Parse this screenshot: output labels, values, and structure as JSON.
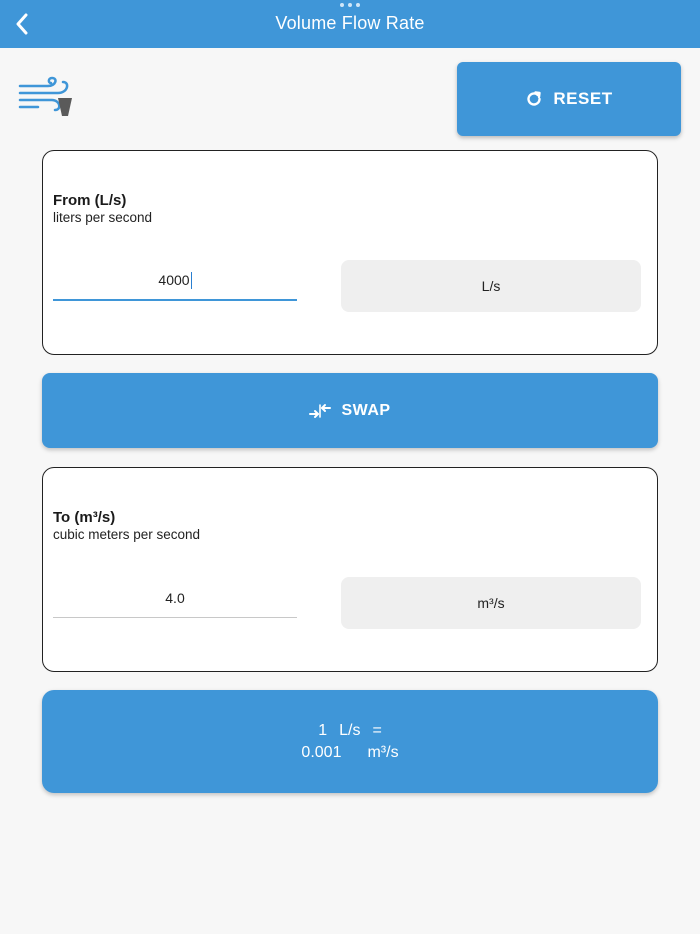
{
  "header": {
    "title": "Volume Flow Rate",
    "back_icon": "chevron-left-icon",
    "background": "#3f96d8"
  },
  "logo_icon": "wind-flow-icon",
  "reset": {
    "label": "RESET",
    "icon": "refresh-icon"
  },
  "from": {
    "title": "From (L/s)",
    "subtitle": "liters per second",
    "value": "4000",
    "unit": "L/s"
  },
  "swap": {
    "label": "SWAP",
    "icon": "swap-arrows-icon"
  },
  "to": {
    "title": "To (m³/s)",
    "subtitle": "cubic meters per second",
    "value": "4.0",
    "unit": "m³/s"
  },
  "result": {
    "line1_value": "1",
    "line1_unit": "L/s",
    "equals": "=",
    "line2_value": "0.001",
    "line2_unit": "m³/s"
  },
  "colors": {
    "accent": "#3f96d8",
    "card_border": "#222222",
    "select_bg": "#efefef"
  }
}
